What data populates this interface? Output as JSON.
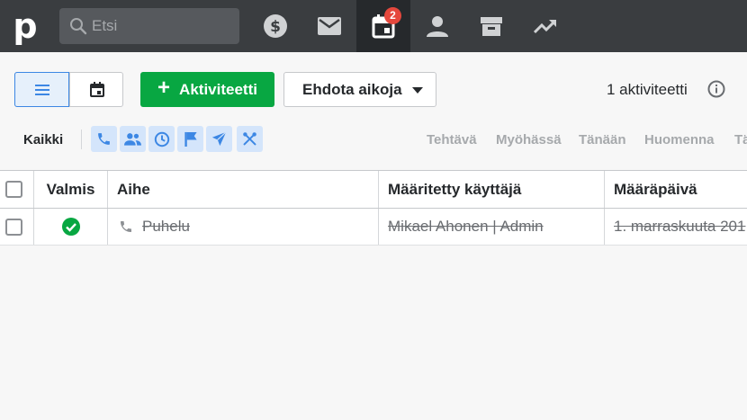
{
  "nav": {
    "logo": "p",
    "search_placeholder": "Etsi",
    "badge_count": "2"
  },
  "toolbar": {
    "add_label": "Aktiviteetti",
    "schedule_label": "Ehdota aikoja",
    "activity_count": "1 aktiviteetti"
  },
  "filters": {
    "all_label": "Kaikki",
    "dates": [
      "Tehtävä",
      "Myöhässä",
      "Tänään",
      "Huomenna",
      "Tä"
    ]
  },
  "table": {
    "columns": [
      "Valmis",
      "Aihe",
      "Määritetty käyttäjä",
      "Määräpäivä"
    ],
    "rows": [
      {
        "subject": "Puhelu",
        "assigned": "Mikael Ahonen | Admin",
        "due": "1. marraskuuta 201"
      }
    ]
  },
  "colors": {
    "accent_green": "#08a742",
    "accent_blue": "#3c87e4",
    "badge_red": "#e5483d",
    "topbar": "#3a3d40"
  }
}
